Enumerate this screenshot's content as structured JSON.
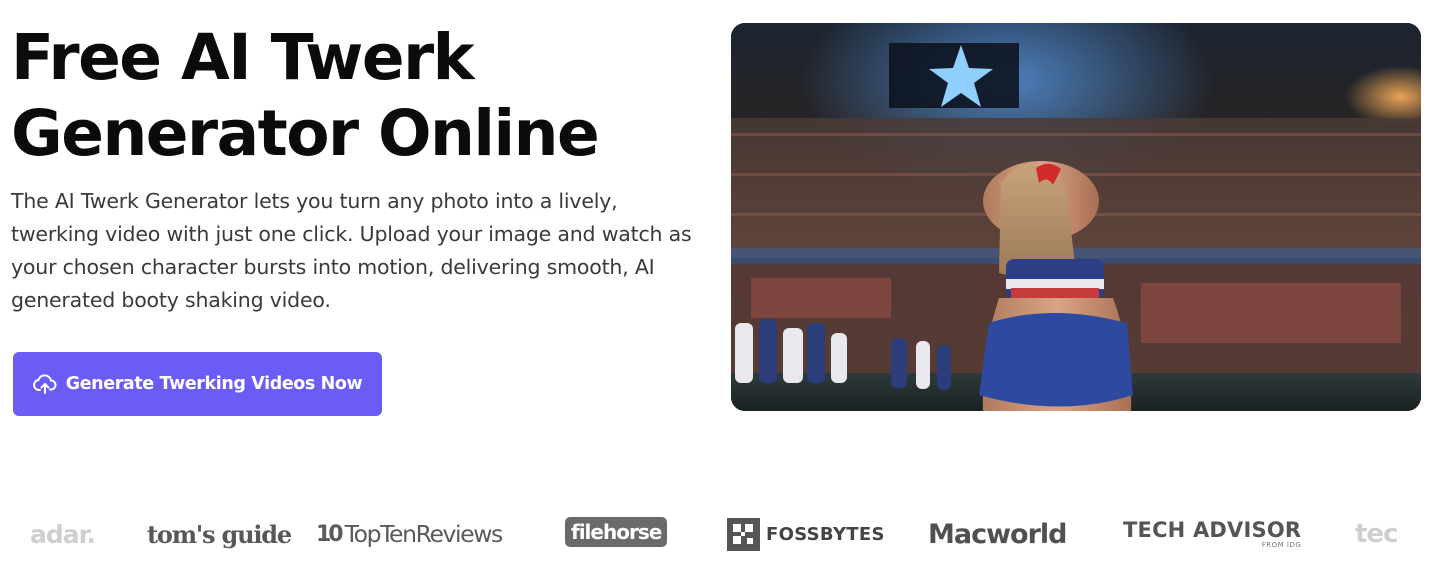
{
  "hero": {
    "title_line1": "Free AI Twerk",
    "title_line2": "Generator Online",
    "description": "The AI Twerk Generator lets you turn any photo into a lively, twerking video with just one click. Upload your image and watch as your chosen character bursts into motion, delivering smooth, AI generated booty shaking video.",
    "cta_label": "Generate Twerking Videos Now",
    "cta_icon": "cloud-upload-icon",
    "accent_color": "#6b5cf6",
    "image_alt": "Cheerleader in a stadium"
  },
  "press_logos": {
    "items": [
      {
        "name": "techradar",
        "text": "adar."
      },
      {
        "name": "toms-guide",
        "text": "tom's guide"
      },
      {
        "name": "topten-reviews",
        "mark": "10",
        "text": "TopTenReviews"
      },
      {
        "name": "filehorse",
        "text": "filehorse"
      },
      {
        "name": "fossbytes",
        "text": "FOSSBYTES"
      },
      {
        "name": "macworld",
        "text": "Macworld"
      },
      {
        "name": "tech-advisor",
        "text": "TECH ADVISOR",
        "sub": "FROM IDG"
      },
      {
        "name": "tech-cut",
        "text": "tec"
      }
    ]
  }
}
